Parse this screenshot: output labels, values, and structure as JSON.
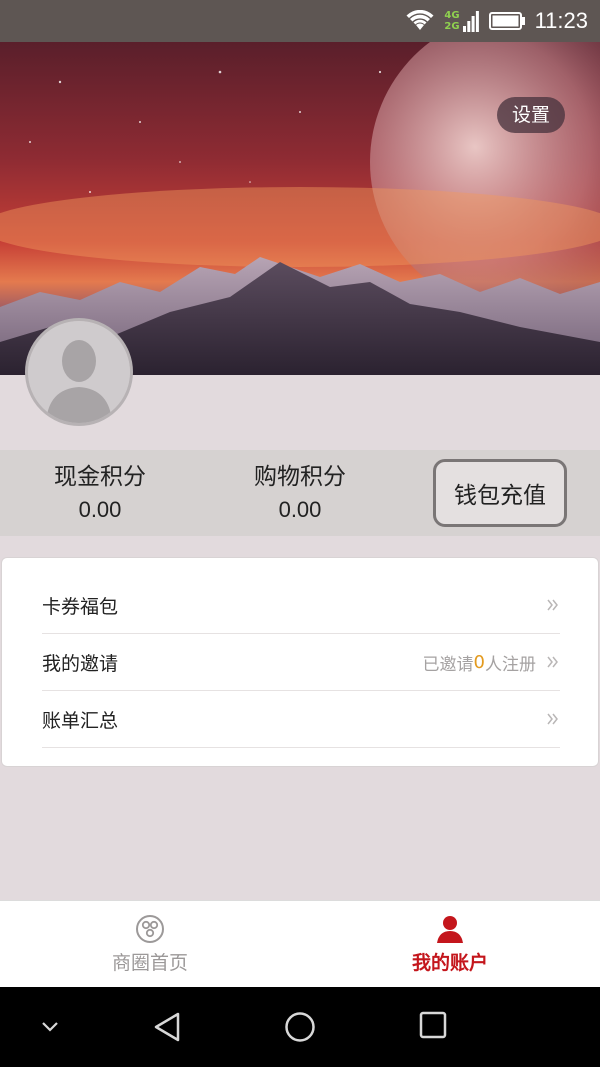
{
  "status_bar": {
    "network_top": "4G",
    "network_bottom": "2G",
    "time": "11:23"
  },
  "header": {
    "settings_label": "设置"
  },
  "points": {
    "cash": {
      "label": "现金积分",
      "value": "0.00"
    },
    "shopping": {
      "label": "购物积分",
      "value": "0.00"
    },
    "recharge_label": "钱包充值"
  },
  "menu": {
    "items": [
      {
        "label": "卡券福包"
      },
      {
        "label": "我的邀请",
        "info_prefix": "已邀请",
        "info_count": "0",
        "info_suffix": "人注册"
      },
      {
        "label": "账单汇总"
      }
    ]
  },
  "tabs": [
    {
      "label": "商圈首页",
      "icon": "shopping-circle-icon",
      "active": false
    },
    {
      "label": "我的账户",
      "icon": "user-icon",
      "active": true
    }
  ],
  "colors": {
    "accent": "#c4161c",
    "highlight_number": "#e39a1e",
    "status_bar": "#5e5653"
  }
}
